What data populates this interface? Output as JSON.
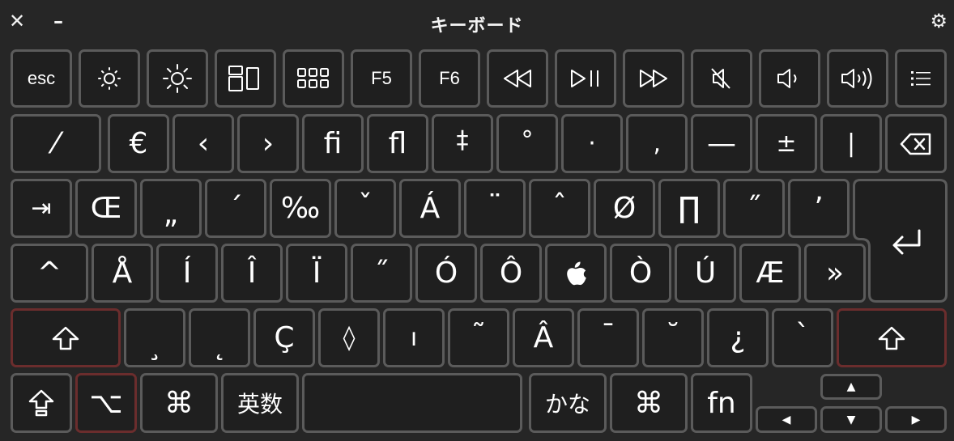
{
  "window": {
    "title": "キーボード",
    "close_glyph": "✕",
    "minimize_glyph": "–",
    "settings_glyph": "⚙"
  },
  "keys": {
    "row1": [
      "esc",
      "brightness-down-icon",
      "brightness-up-icon",
      "mission-control-icon",
      "launchpad-icon",
      "F5",
      "F6",
      "rewind-icon",
      "play-pause-icon",
      "fast-forward-icon",
      "mute-icon",
      "volume-down-icon",
      "volume-up-icon",
      "list-icon"
    ],
    "row2": [
      "⁄",
      "€",
      "‹",
      "›",
      "ﬁ",
      "ﬂ",
      "‡",
      "°",
      "·",
      "‚",
      "—",
      "±",
      "|"
    ],
    "row3": [
      "⇥",
      "Œ",
      "„",
      "´",
      "‰",
      "ˇ",
      "Á",
      "¨",
      "ˆ",
      "Ø",
      "∏",
      "˝",
      "’"
    ],
    "row4": [
      "^",
      "Å",
      "Í",
      "Î",
      "Ï",
      "˝",
      "Ó",
      "Ô",
      "",
      "Ò",
      "Ú",
      "Æ",
      "»"
    ],
    "row5": [
      "¸",
      "˛",
      "Ç",
      "◊",
      "ı",
      "˜",
      "Â",
      "¯",
      "˘",
      "¿",
      "`"
    ],
    "row6": {
      "option": "⌥",
      "command_left": "⌘",
      "eisu": "英数",
      "space": "",
      "kana": "かな",
      "command_right": "⌘",
      "fn": "fn",
      "arrow_up": "▲",
      "arrow_left": "◀",
      "arrow_down": "▼",
      "arrow_right": "▶"
    }
  },
  "colors": {
    "background": "#262626",
    "key_fill": "#1f1f1f",
    "key_border": "#5b5b5b",
    "active_modifier_border": "#6b2d2d"
  }
}
